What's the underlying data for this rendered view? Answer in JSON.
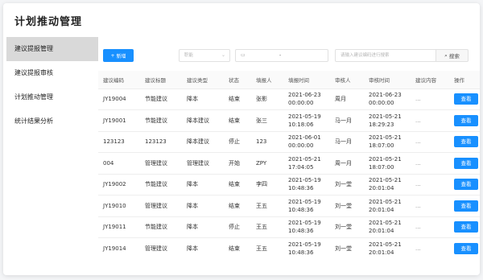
{
  "app": {
    "title": "计划推动管理"
  },
  "sidebar": {
    "items": [
      {
        "label": "建议提报管理",
        "active": true
      },
      {
        "label": "建议提报审核",
        "active": false
      },
      {
        "label": "计划推动管理",
        "active": false
      },
      {
        "label": "统计结果分析",
        "active": false
      }
    ]
  },
  "toolbar": {
    "new_label": "新增",
    "type_select_placeholder": "职能",
    "date_separator": "-",
    "search_placeholder": "请输入建议编码进行搜索",
    "search_label": "搜索"
  },
  "table": {
    "columns": [
      "建议编码",
      "建议标题",
      "建议类型",
      "状态",
      "填报人",
      "填报时间",
      "审核人",
      "审核时间",
      "建议内容",
      "操作"
    ],
    "rows": [
      {
        "code": "JY19004",
        "title": "节能建议",
        "type": "降本",
        "status": "结束",
        "reporter": "张影",
        "report_date": "2021-06-23",
        "report_time": "00:00:00",
        "reviewer": "周月",
        "review_date": "2021-06-23",
        "review_time": "00:00:00",
        "content": "...",
        "action": "查看"
      },
      {
        "code": "JY19001",
        "title": "节能建议",
        "type": "降本建议",
        "status": "结束",
        "reporter": "张三",
        "report_date": "2021-05-19",
        "report_time": "10:18:06",
        "reviewer": "马一月",
        "review_date": "2021-05-21",
        "review_time": "18:29:23",
        "content": "...",
        "action": "查看"
      },
      {
        "code": "123123",
        "title": "123123",
        "type": "降本建议",
        "status": "停止",
        "reporter": "123",
        "report_date": "2021-06-01",
        "report_time": "00:00:00",
        "reviewer": "马一月",
        "review_date": "2021-05-21",
        "review_time": "18:07:00",
        "content": "...",
        "action": "查看"
      },
      {
        "code": "004",
        "title": "管理建议",
        "type": "管理建议",
        "status": "开始",
        "reporter": "ZPY",
        "report_date": "2021-05-21",
        "report_time": "17:04:05",
        "reviewer": "周一月",
        "review_date": "2021-05-21",
        "review_time": "18:07:00",
        "content": "...",
        "action": "查看"
      },
      {
        "code": "JY19002",
        "title": "节能建议",
        "type": "降本",
        "status": "结束",
        "reporter": "李四",
        "report_date": "2021-05-19",
        "report_time": "10:48:36",
        "reviewer": "刘一堂",
        "review_date": "2021-05-21",
        "review_time": "20:01:04",
        "content": "...",
        "action": "查看"
      },
      {
        "code": "JY19010",
        "title": "管理建议",
        "type": "降本",
        "status": "结束",
        "reporter": "王五",
        "report_date": "2021-05-19",
        "report_time": "10:48:36",
        "reviewer": "刘一堂",
        "review_date": "2021-05-21",
        "review_time": "20:01:04",
        "content": "...",
        "action": "查看"
      },
      {
        "code": "JY19011",
        "title": "节能建议",
        "type": "降本",
        "status": "停止",
        "reporter": "王五",
        "report_date": "2021-05-19",
        "report_time": "10:48:36",
        "reviewer": "刘一堂",
        "review_date": "2021-05-21",
        "review_time": "20:01:04",
        "content": "...",
        "action": "查看"
      },
      {
        "code": "JY19014",
        "title": "管理建议",
        "type": "降本",
        "status": "结束",
        "reporter": "王五",
        "report_date": "2021-05-19",
        "report_time": "10:48:36",
        "reviewer": "刘一堂",
        "review_date": "2021-05-21",
        "review_time": "20:01:04",
        "content": "...",
        "action": "查看"
      }
    ]
  }
}
